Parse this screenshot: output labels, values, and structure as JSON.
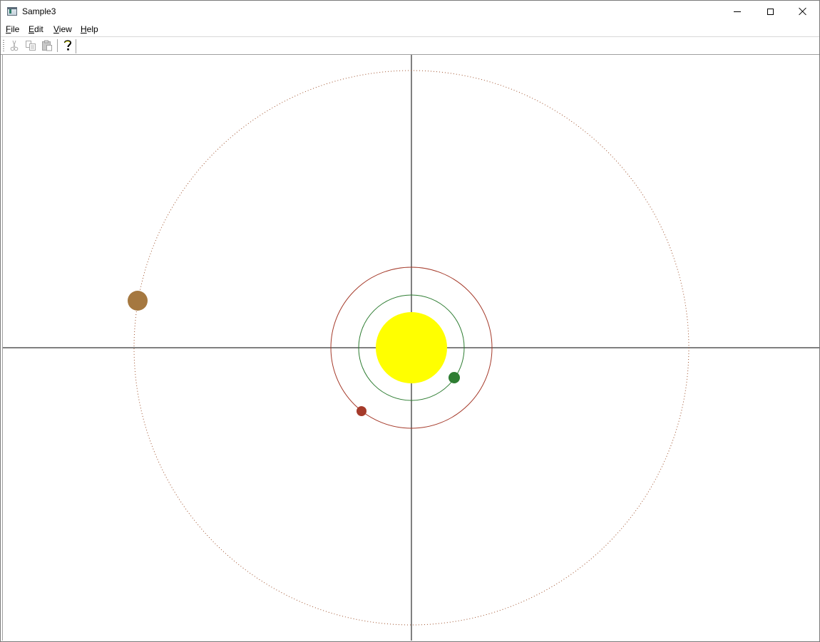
{
  "window": {
    "title": "Sample3",
    "icon": "app-window-icon",
    "controls": [
      "minimize-icon",
      "maximize-icon",
      "close-icon"
    ]
  },
  "menu": {
    "items": [
      {
        "label": "File",
        "mnemonic": "F"
      },
      {
        "label": "Edit",
        "mnemonic": "E"
      },
      {
        "label": "View",
        "mnemonic": "V"
      },
      {
        "label": "Help",
        "mnemonic": "H"
      }
    ]
  },
  "toolbar": {
    "buttons": [
      {
        "icon": "cut-icon",
        "enabled": false
      },
      {
        "icon": "copy-icon",
        "enabled": false
      },
      {
        "icon": "paste-icon",
        "enabled": false
      },
      {
        "icon": "help-icon",
        "enabled": true
      }
    ]
  },
  "scene": {
    "sun": {
      "color": "#ffff00"
    },
    "axes": {
      "color": "#000000"
    },
    "orbits": [
      {
        "name": "inner",
        "color": "#2e7d32",
        "style": "solid"
      },
      {
        "name": "middle",
        "color": "#a53a2a",
        "style": "solid"
      },
      {
        "name": "outer",
        "color": "#a0522d",
        "style": "dotted"
      }
    ],
    "planets": [
      {
        "orbit": "inner",
        "color": "#2e7d32"
      },
      {
        "orbit": "middle",
        "color": "#a53a2a"
      },
      {
        "orbit": "outer",
        "color": "#a57840"
      }
    ]
  }
}
